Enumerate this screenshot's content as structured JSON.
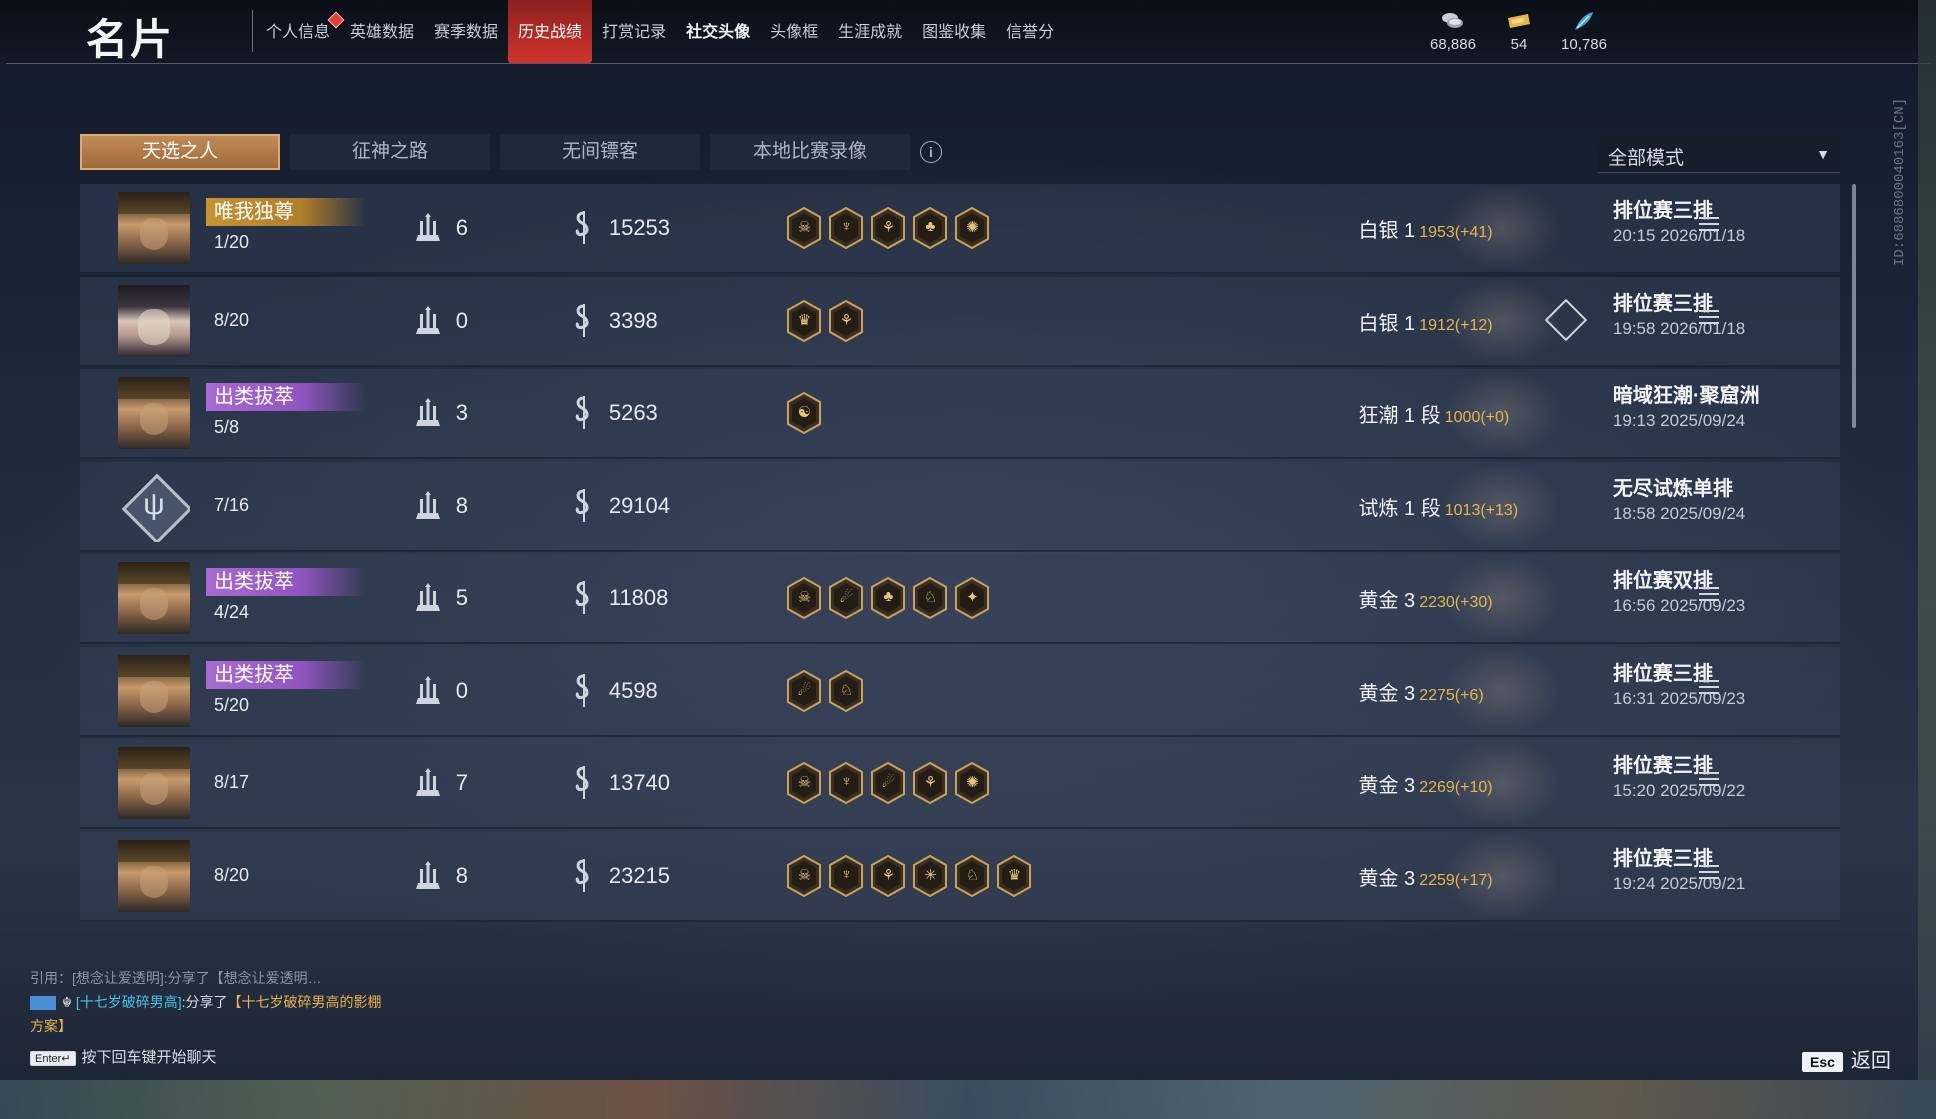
{
  "header": {
    "title": "名片",
    "nav": [
      {
        "label": "个人信息",
        "has_dot": true
      },
      {
        "label": "英雄数据"
      },
      {
        "label": "赛季数据"
      },
      {
        "label": "历史战绩",
        "active": true
      },
      {
        "label": "打赏记录"
      },
      {
        "label": "社交头像",
        "bright": true
      },
      {
        "label": "头像框"
      },
      {
        "label": "生涯成就"
      },
      {
        "label": "图鉴收集"
      },
      {
        "label": "信誉分"
      }
    ],
    "currencies": [
      {
        "icon": "coin-stack-icon",
        "value": "68,886"
      },
      {
        "icon": "ticket-icon",
        "value": "54"
      },
      {
        "icon": "feather-icon",
        "value": "10,786"
      }
    ],
    "user_id": "ID:6886800040163[CN]"
  },
  "subtabs": [
    {
      "label": "天选之人",
      "active": true
    },
    {
      "label": "征神之路"
    },
    {
      "label": "无间镖客"
    },
    {
      "label": "本地比赛录像"
    }
  ],
  "mode_filter": {
    "value": "全部模式"
  },
  "matches": [
    {
      "avatar": "hero1",
      "badge": "唯我独尊",
      "badge_color": "gold",
      "kda": "1/20",
      "towers": "6",
      "gold": "15253",
      "equips": [
        "☠",
        "♆",
        "⚘",
        "♣",
        "✺"
      ],
      "rank": "白银 1",
      "rank_points": "1953(+41)",
      "mode": "排位赛三排",
      "time": "20:15  2026/01/18"
    },
    {
      "avatar": "hero2",
      "badge": "",
      "kda": "8/20",
      "towers": "0",
      "gold": "3398",
      "equips": [
        "♛",
        "⚘"
      ],
      "rank": "白银 1",
      "rank_points": "1912(+12)",
      "mode": "排位赛三排",
      "time": "19:58  2026/01/18",
      "stat_icon": true
    },
    {
      "avatar": "hero1",
      "badge": "出类拔萃",
      "badge_color": "purple",
      "kda": "5/8",
      "towers": "3",
      "gold": "5263",
      "equips": [
        "☯"
      ],
      "rank": "狂潮 1 段",
      "rank_points": "1000(+0)",
      "mode": "暗域狂潮·聚窟洲",
      "time": "19:13  2025/09/24",
      "no_menu": true
    },
    {
      "avatar": "diamond",
      "badge": "",
      "kda": "7/16",
      "towers": "8",
      "gold": "29104",
      "equips": [],
      "rank": "试炼 1 段",
      "rank_points": "1013(+13)",
      "mode": "无尽试炼单排",
      "time": "18:58  2025/09/24",
      "no_menu": true
    },
    {
      "avatar": "hero1",
      "badge": "出类拔萃",
      "badge_color": "purple",
      "kda": "4/24",
      "towers": "5",
      "gold": "11808",
      "equips": [
        "☠",
        "☄",
        "♣",
        "♘",
        "✦"
      ],
      "rank": "黄金 3",
      "rank_points": "2230(+30)",
      "mode": "排位赛双排",
      "time": "16:56  2025/09/23"
    },
    {
      "avatar": "hero1",
      "badge": "出类拔萃",
      "badge_color": "purple",
      "kda": "5/20",
      "towers": "0",
      "gold": "4598",
      "equips": [
        "☄",
        "♘"
      ],
      "rank": "黄金 3",
      "rank_points": "2275(+6)",
      "mode": "排位赛三排",
      "time": "16:31  2025/09/23"
    },
    {
      "avatar": "hero1",
      "badge": "",
      "kda": "8/17",
      "towers": "7",
      "gold": "13740",
      "equips": [
        "☠",
        "♆",
        "☄",
        "⚘",
        "✺"
      ],
      "rank": "黄金 3",
      "rank_points": "2269(+10)",
      "mode": "排位赛三排",
      "time": "15:20  2025/09/22"
    },
    {
      "avatar": "hero1",
      "badge": "",
      "kda": "8/20",
      "towers": "8",
      "gold": "23215",
      "equips": [
        "☠",
        "♆",
        "⚘",
        "✳",
        "♘",
        "♛"
      ],
      "rank": "黄金 3",
      "rank_points": "2259(+17)",
      "mode": "排位赛三排",
      "time": "19:24  2025/09/21"
    }
  ],
  "chat": {
    "quote": "引用：[想念让爱透明]:分享了【想念让爱透明…",
    "name": "[十七岁破碎男高]",
    "verb": ":分享了",
    "share": "【十七岁破碎男高的影棚方案】",
    "hint_key": "Enter↵",
    "hint": "按下回车键开始聊天"
  },
  "footer": {
    "esc_key": "Esc",
    "back_label": "返回"
  }
}
